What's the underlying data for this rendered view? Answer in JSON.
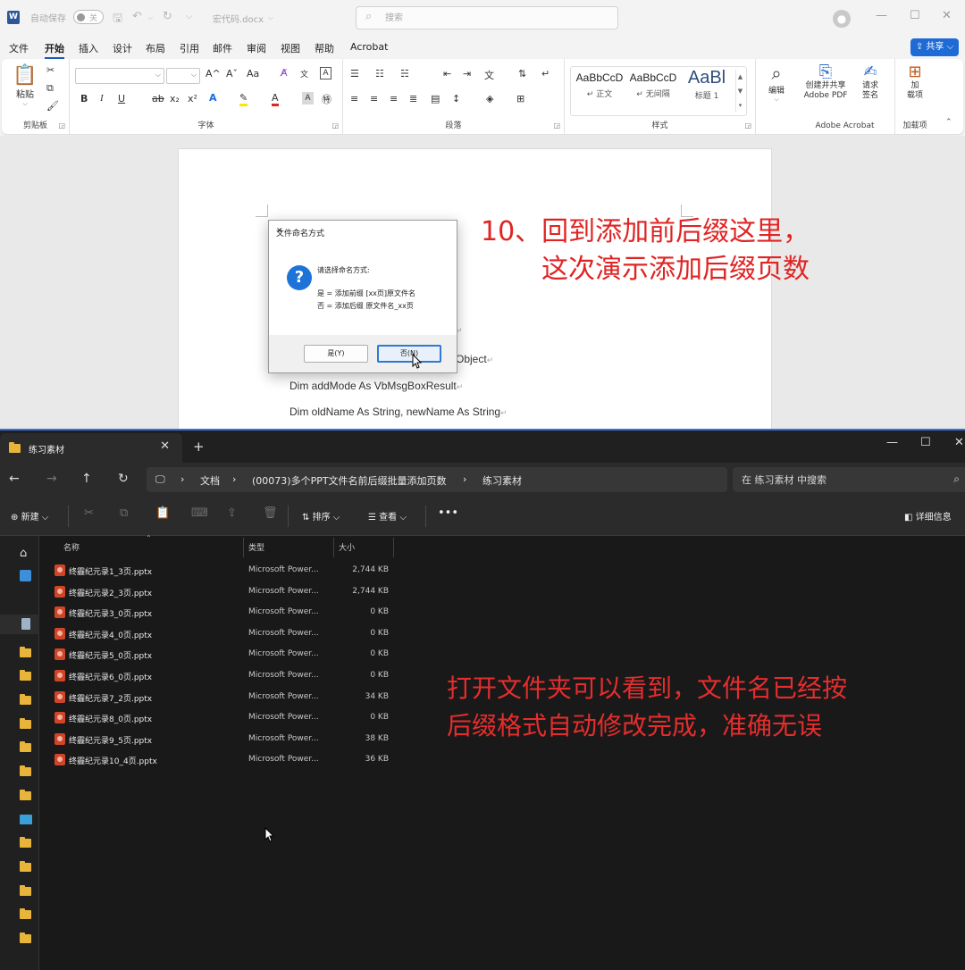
{
  "word": {
    "autosave_label": "自动保存",
    "autosave_state": "关",
    "doc_name": "宏代码.docx",
    "search_placeholder": "搜索",
    "menu": [
      "文件",
      "开始",
      "插入",
      "设计",
      "布局",
      "引用",
      "邮件",
      "审阅",
      "视图",
      "帮助",
      "Acrobat"
    ],
    "share_label": "共享",
    "ribbon": {
      "clipboard": {
        "paste": "粘贴",
        "label": "剪贴板"
      },
      "font": {
        "label": "字体",
        "grow": "A^",
        "shrink": "Aˇ",
        "case": "Aa"
      },
      "paragraph": {
        "label": "段落"
      },
      "styles": {
        "label": "样式",
        "items": [
          {
            "sample": "AaBbCcD",
            "name": "正文"
          },
          {
            "sample": "AaBbCcD",
            "name": "无间隔"
          },
          {
            "sample": "AaBl",
            "name": "标题 1"
          }
        ]
      },
      "edit": {
        "label": "编辑"
      },
      "acrobat": {
        "create_pdf": "创建并共享\nAdobe PDF",
        "sign": "请求\n签名",
        "label": "Adobe Acrobat"
      },
      "addins": {
        "load": "加\n载项",
        "label": "加载项"
      }
    },
    "code_lines": [
      "Object",
      "Dim addMode As VbMsgBoxResult",
      "Dim oldName As String, newName As String"
    ]
  },
  "dialog": {
    "title": "文件命名方式",
    "prompt": "请选择命名方式:",
    "line_yes": "是 = 添加前缀 [xx页]原文件名",
    "line_no": "否 = 添加后缀 原文件名_xx页",
    "btn_yes": "是(Y)",
    "btn_no": "否(N)"
  },
  "annotation_top": {
    "line1": "10、回到添加前后缀这里，",
    "line2": "这次演示添加后缀页数"
  },
  "explorer": {
    "tab_title": "练习素材",
    "breadcrumb": [
      "文档",
      "(00073)多个PPT文件名前后缀批量添加页数",
      "练习素材"
    ],
    "search_placeholder": "在 练习素材 中搜索",
    "cmd": {
      "new": "新建",
      "sort": "排序",
      "view": "查看",
      "details": "详细信息"
    },
    "columns": {
      "name": "名称",
      "type": "类型",
      "size": "大小"
    },
    "files": [
      {
        "name": "终霾纪元录1_3页.pptx",
        "type": "Microsoft Power...",
        "size": "2,744 KB"
      },
      {
        "name": "终霾纪元录2_3页.pptx",
        "type": "Microsoft Power...",
        "size": "2,744 KB"
      },
      {
        "name": "终霾纪元录3_0页.pptx",
        "type": "Microsoft Power...",
        "size": "0 KB"
      },
      {
        "name": "终霾纪元录4_0页.pptx",
        "type": "Microsoft Power...",
        "size": "0 KB"
      },
      {
        "name": "终霾纪元录5_0页.pptx",
        "type": "Microsoft Power...",
        "size": "0 KB"
      },
      {
        "name": "终霾纪元录6_0页.pptx",
        "type": "Microsoft Power...",
        "size": "0 KB"
      },
      {
        "name": "终霾纪元录7_2页.pptx",
        "type": "Microsoft Power...",
        "size": "34 KB"
      },
      {
        "name": "终霾纪元录8_0页.pptx",
        "type": "Microsoft Power...",
        "size": "0 KB"
      },
      {
        "name": "终霾纪元录9_5页.pptx",
        "type": "Microsoft Power...",
        "size": "38 KB"
      },
      {
        "name": "终霾纪元录10_4页.pptx",
        "type": "Microsoft Power...",
        "size": "36 KB"
      }
    ],
    "annotation": {
      "line1": "打开文件夹可以看到，文件名已经按",
      "line2": "后缀格式自动修改完成，准确无误"
    }
  },
  "colors": {
    "annotation_red": "#e02424",
    "word_accent": "#185abd",
    "explorer_bg": "#1c1c1c",
    "folder_yellow": "#e8b43a"
  }
}
